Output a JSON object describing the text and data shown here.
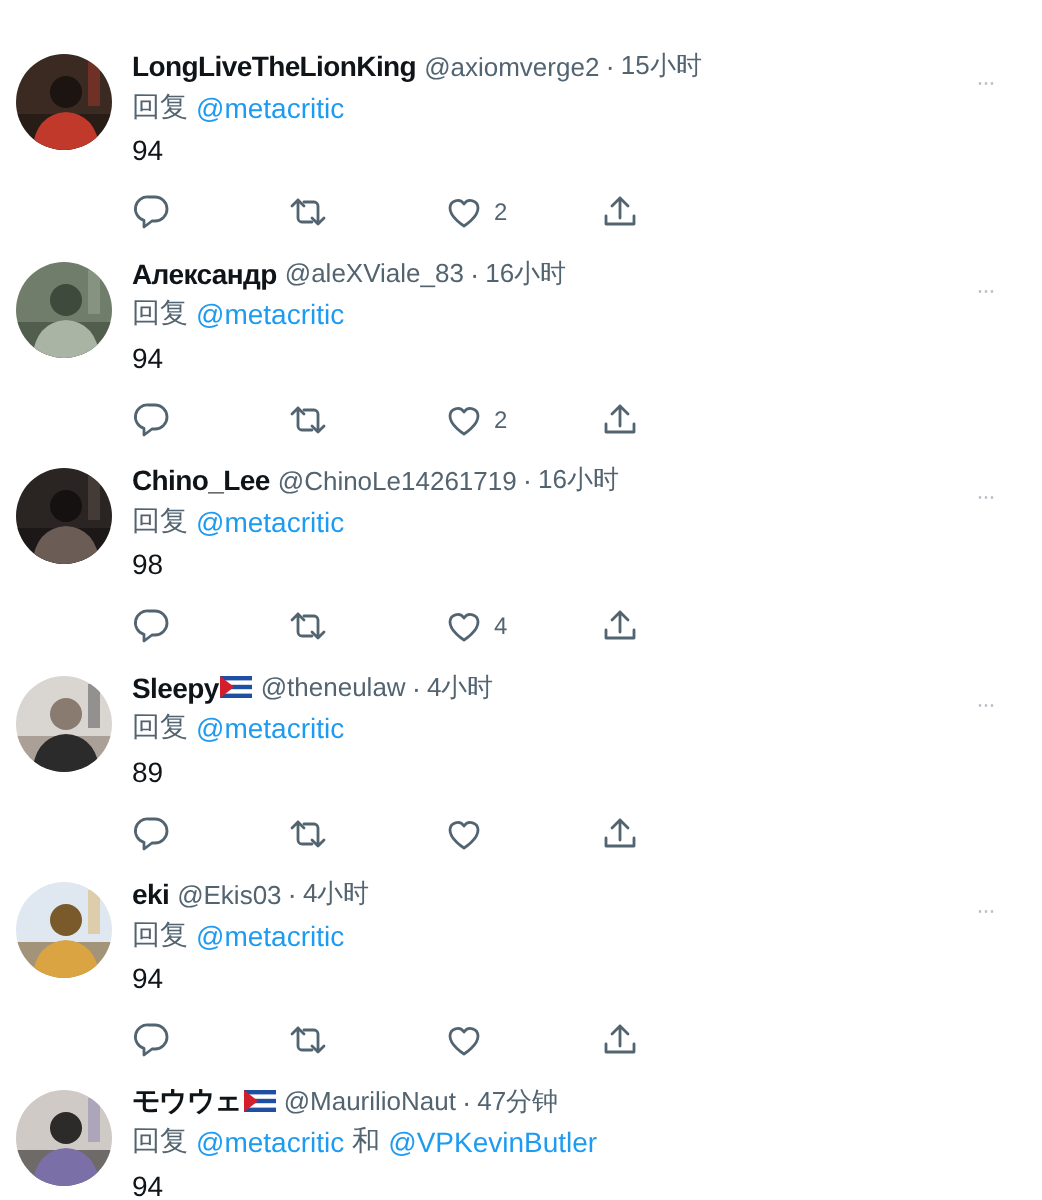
{
  "tweets": [
    {
      "name": "LongLiveTheLionKing",
      "flag": false,
      "handle": "@axiomverge2",
      "separator": "·",
      "time": "15小时",
      "more": "···",
      "reply_prefix": "回复",
      "mentions": [
        "@metacritic"
      ],
      "text": "94",
      "actions": true,
      "likes": "2"
    },
    {
      "name": "Александр",
      "flag": false,
      "handle": "@aleXViale_83",
      "separator": "·",
      "time": "16小时",
      "more": "···",
      "reply_prefix": "回复",
      "mentions": [
        "@metacritic"
      ],
      "text": "94",
      "actions": true,
      "likes": "2"
    },
    {
      "name": "Chino_Lee",
      "flag": false,
      "handle": "@ChinoLe14261719",
      "separator": "·",
      "time": "16小时",
      "more": "···",
      "reply_prefix": "回复",
      "mentions": [
        "@metacritic"
      ],
      "text": "98",
      "actions": true,
      "likes": "4"
    },
    {
      "name": "Sleepy",
      "flag": true,
      "handle": "@theneulaw",
      "separator": "·",
      "time": "4小时",
      "more": "···",
      "reply_prefix": "回复",
      "mentions": [
        "@metacritic"
      ],
      "text": "89",
      "actions": true
    },
    {
      "name": "eki",
      "flag": false,
      "handle": "@Ekis03",
      "separator": "·",
      "time": "4小时",
      "more": "···",
      "reply_prefix": "回复",
      "mentions": [
        "@metacritic"
      ],
      "text": "94",
      "actions": true
    },
    {
      "name": "モウウェ",
      "flag": true,
      "handle": "@MaurilioNaut",
      "separator": "·",
      "time": "47分钟",
      "reply_prefix": "回复",
      "mentions": [
        "@metacritic",
        "@VPKevinButler"
      ],
      "mention_joiner": "和",
      "text": "94",
      "actions": false
    }
  ]
}
